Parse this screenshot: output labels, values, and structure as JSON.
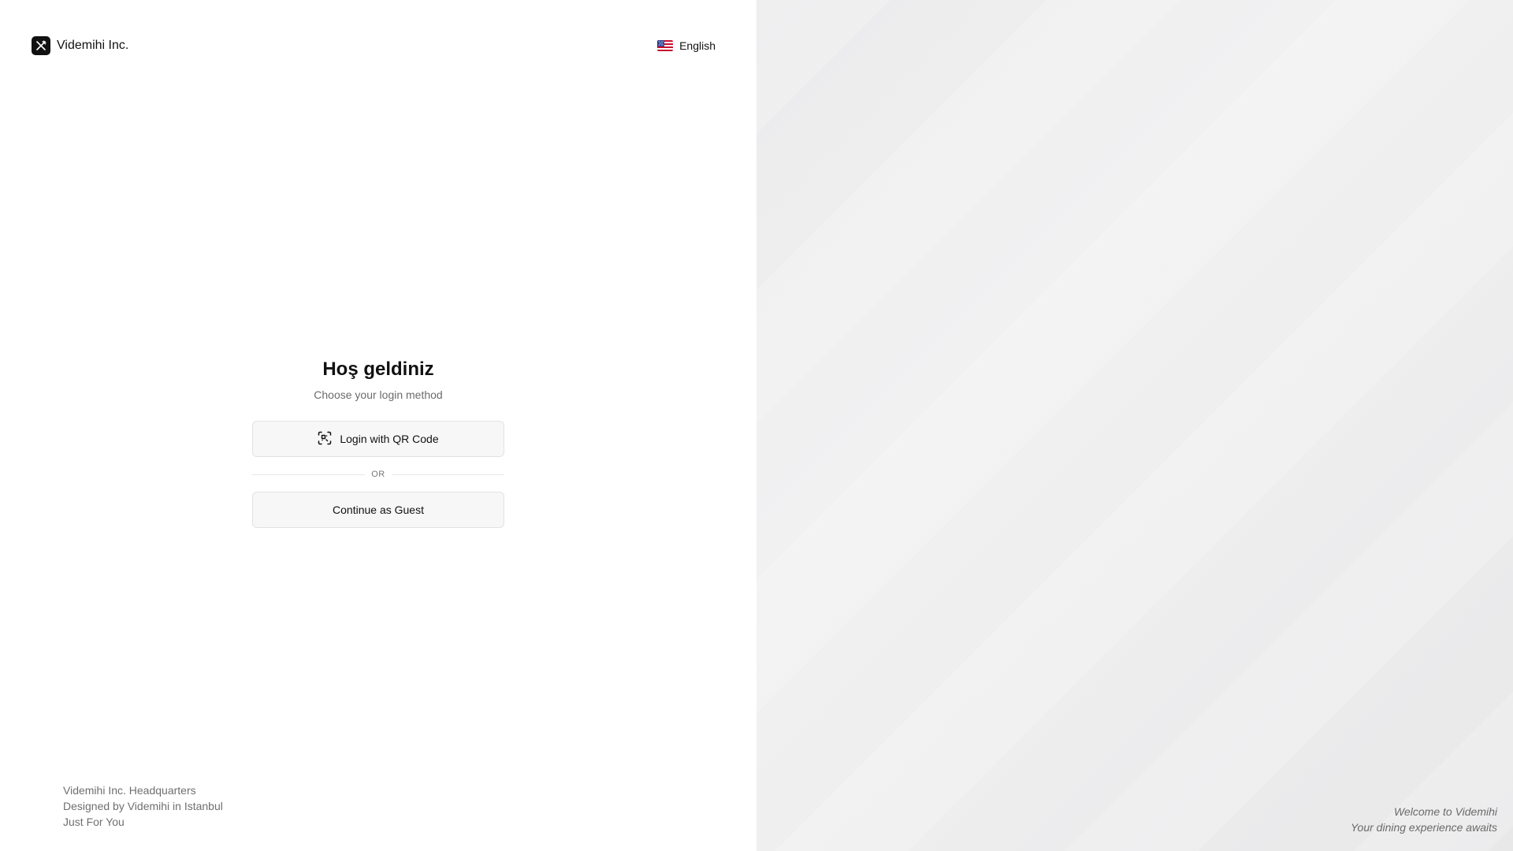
{
  "brand": {
    "name": "Videmihi Inc.",
    "logo_icon": "crossed-utensils-icon"
  },
  "language": {
    "label": "English",
    "flag_icon": "us-flag-icon"
  },
  "login": {
    "title": "Hoş geldiniz",
    "subtitle": "Choose your login method",
    "qr_button_label": "Login with QR Code",
    "qr_icon": "qr-scan-icon",
    "divider_text": "OR",
    "guest_button_label": "Continue as Guest"
  },
  "footer": {
    "line1": "Videmihi Inc. Headquarters",
    "line2": "Designed by Videmihi in Istanbul",
    "line3": "Just For You"
  },
  "hero": {
    "line1": "Welcome to Videmihi",
    "line2": "Your dining experience awaits"
  },
  "colors": {
    "primary": "#111111",
    "muted_text": "#6b6b6b",
    "button_bg": "#f7f7f7",
    "button_border": "#e2e2e2",
    "panel_bg": "#ececed"
  }
}
